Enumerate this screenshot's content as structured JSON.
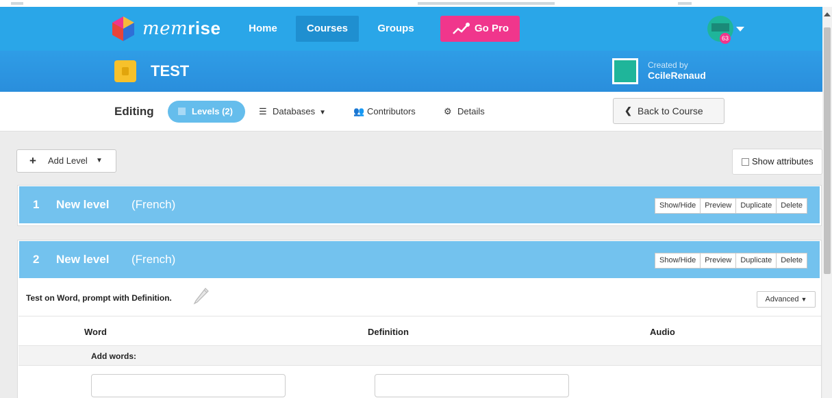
{
  "nav": {
    "brand_light": "mem",
    "brand_bold": "rise",
    "home": "Home",
    "courses": "Courses",
    "groups": "Groups",
    "go_pro": "Go Pro",
    "avatar_badge": "63"
  },
  "course": {
    "title": "TEST",
    "created_by": "Created by",
    "creator": "CcileRenaud"
  },
  "edit_bar": {
    "editing": "Editing",
    "levels_tab": "Levels (2)",
    "databases_tab": "Databases",
    "contributors_tab": "Contributors",
    "details_tab": "Details",
    "back_button": "Back to Course"
  },
  "toolbar": {
    "add_level": "Add Level",
    "show_attributes": "Show attributes"
  },
  "levels": [
    {
      "number": "1",
      "name": "New level",
      "language": "(French)"
    },
    {
      "number": "2",
      "name": "New level",
      "language": "(French)"
    }
  ],
  "level_actions": [
    "Show/Hide",
    "Preview",
    "Duplicate",
    "Delete"
  ],
  "level2_detail": {
    "test_description": "Test on Word, prompt with Definition.",
    "advanced": "Advanced",
    "columns": [
      "Word",
      "Definition",
      "Audio"
    ],
    "add_words": "Add words:"
  },
  "colors": {
    "nav_bg": "#2aa6e8",
    "go_pro": "#f0368c",
    "level_bar": "#73c2ee",
    "levels_tab": "#65bdec"
  }
}
